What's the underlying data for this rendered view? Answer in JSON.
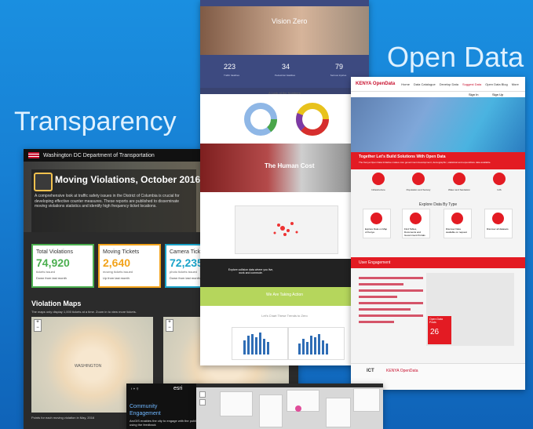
{
  "hero": {
    "transparency": "Transparency",
    "open_data": "Open Data"
  },
  "dc": {
    "org": "Washington DC Department of Transportation",
    "title": "Moving Violations, October 2016",
    "description": "A comprehensive look at traffic safety issues in the District of Columbia is crucial for developing effective counter measures. These reports are published to disseminate moving violations statistics and identify high frequency ticket locations.",
    "stats": [
      {
        "label": "Total Violations",
        "value": "74,920",
        "sub": "tickets issued",
        "change": "Down from last month",
        "color": "#4caf50"
      },
      {
        "label": "Moving Tickets",
        "value": "2,640",
        "sub": "moving tickets issued",
        "change": "Up from last month",
        "color": "#f2a31b"
      },
      {
        "label": "Camera Tickets",
        "value": "72,235",
        "sub": "photo tickets issued",
        "change": "Down from last month",
        "color": "#1aa3c9"
      }
    ],
    "maps_title": "Violation Maps",
    "maps_sub": "The maps only display 1,000 tickets at a time. Zoom in to view more tickets.",
    "map_label": "WASHINGTON",
    "footer": "Points for each moving violation in May, 2016"
  },
  "vision_zero": {
    "title": "Vision Zero",
    "stats": [
      {
        "value": "223",
        "label": "Traffic fatalities"
      },
      {
        "value": "34",
        "label": "Pedestrian fatalities"
      },
      {
        "value": "79",
        "label": "Serious injuries"
      }
    ],
    "look": "A Look at the Numbers",
    "human_cost": "The Human Cost",
    "explore": "Explore collision data where you live, work and commute.",
    "action": "We Are Taking Action",
    "trends": "Let's Chart These Trends to Zero"
  },
  "kenya": {
    "logo": "KENYA OpenData",
    "nav": [
      "Home",
      "Data Catalogue",
      "Develop Data",
      "Suggest Data",
      "Open Data Blog",
      "More"
    ],
    "auth": [
      "Sign In",
      "Sign Up"
    ],
    "headline": "Together Let's Build Solutions With Open Data",
    "subline": "The Kenya Open Data Initiative makes core government development, demographic, statistical and expenditure data available.",
    "categories": [
      "Infrastructure",
      "Population and Society",
      "Water and Sanitation",
      "GIS"
    ],
    "explore_title": "Explore Data By Type",
    "types": [
      "Explore Data on Map of Kenya",
      "Find Tables, Documents and Government Portals",
      "Discover Data available on request",
      "Discover all datasets"
    ],
    "user_engagement": "User Engagement",
    "gauge_label": "Open Data Posts",
    "gauge_value": "26",
    "footer_ict": "ICT",
    "footer_kenya": "KENYA OpenData"
  },
  "esri": {
    "logo": "esri",
    "heading1": "Community",
    "heading2": "Engagement",
    "text": "ArcGIS enables the city to engage with the public using the feedback"
  },
  "colors": {
    "background": "#1780d4",
    "accent_red": "#e31b23",
    "vz_blue": "#3d4a80"
  }
}
